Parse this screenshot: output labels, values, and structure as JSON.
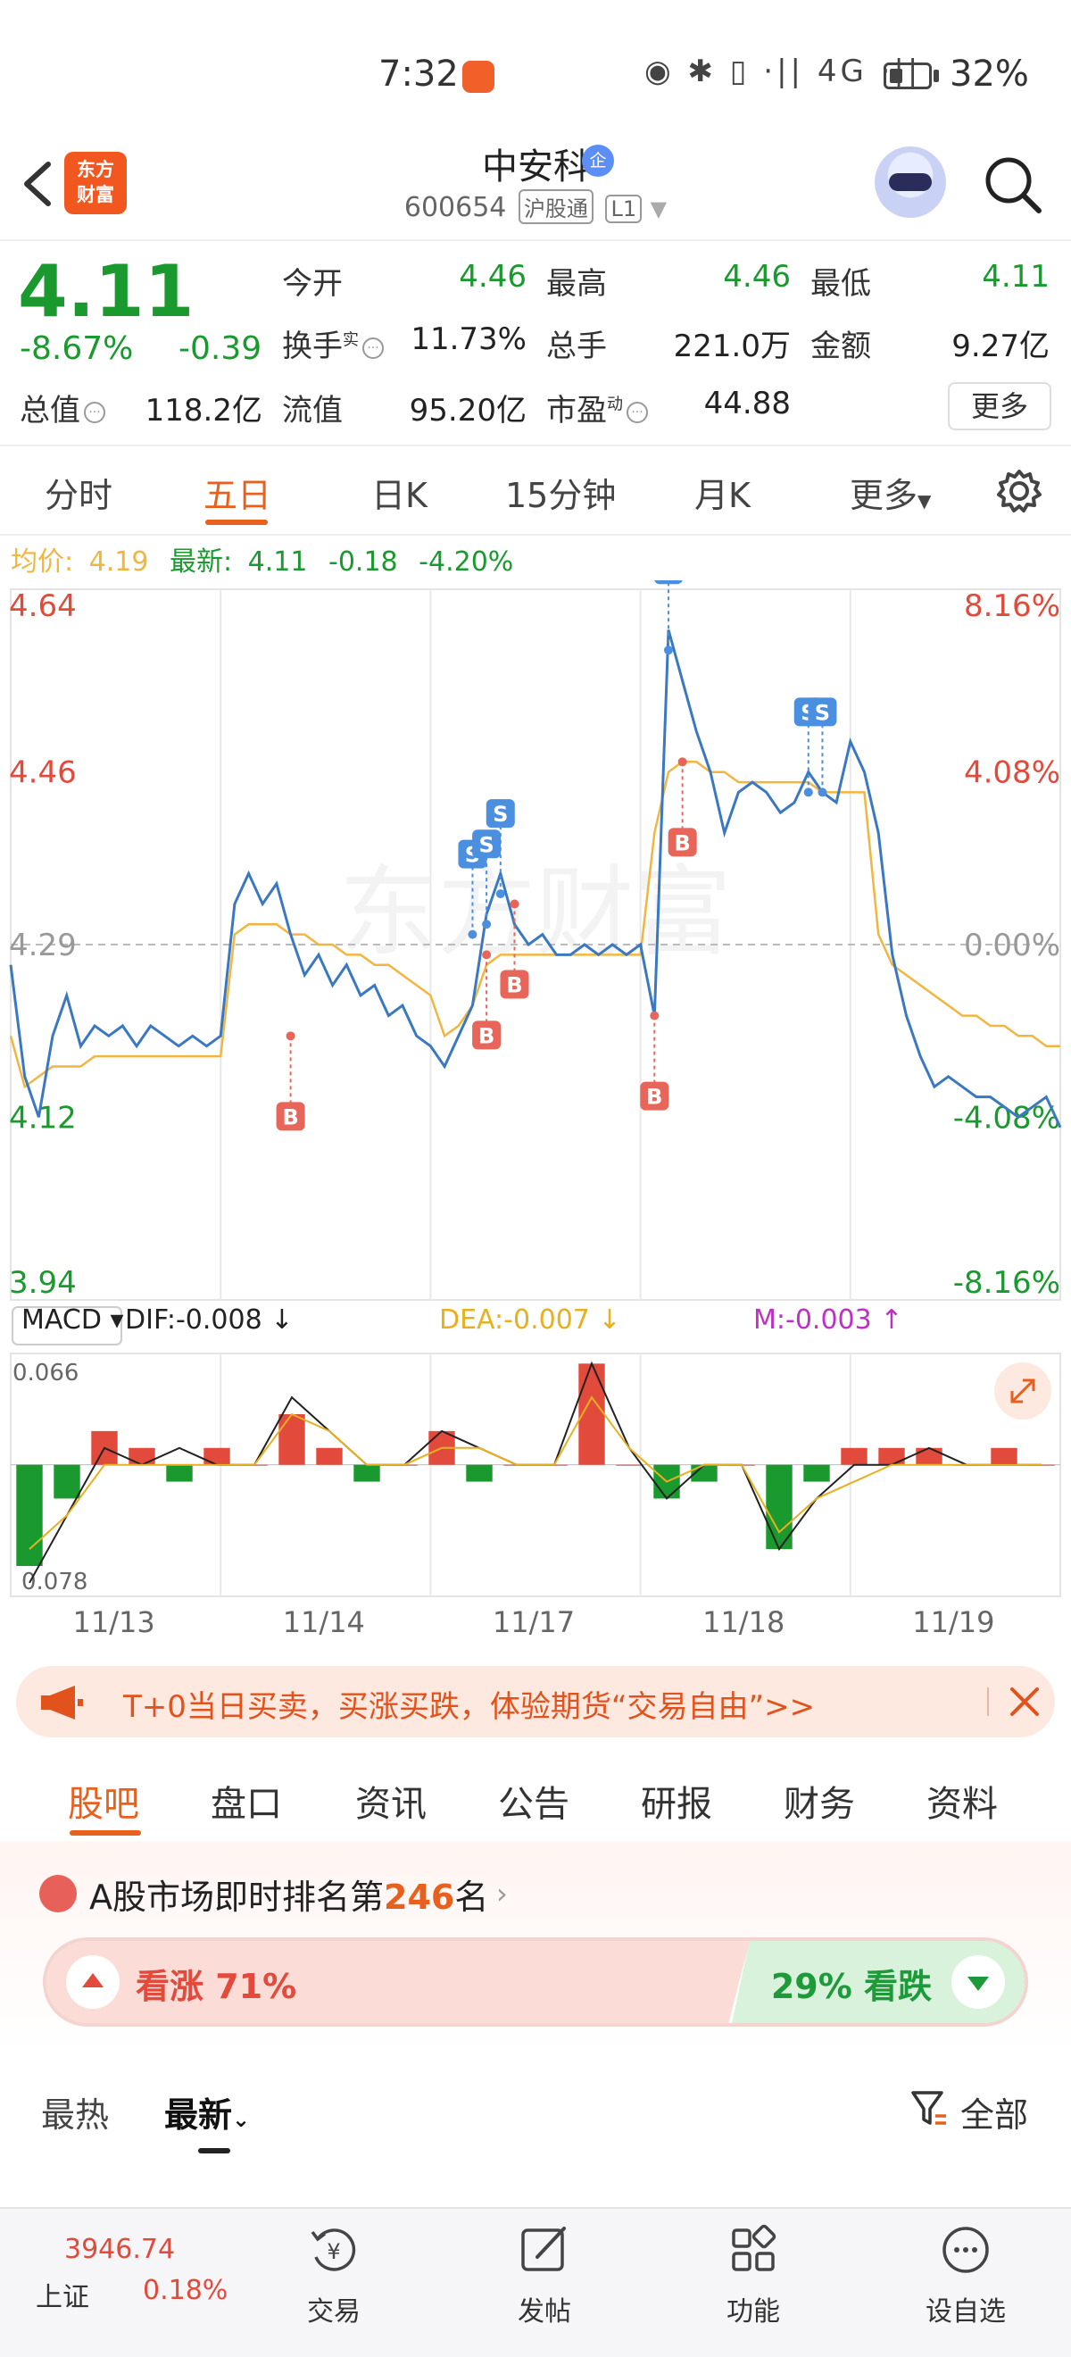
{
  "status_bar": {
    "time": "7:32",
    "battery": "32%",
    "signal_icons": "◉ ✱ ▯ ·|| 4G ·||"
  },
  "header": {
    "logo_text": "东方\n财富",
    "stock_name": "中安科",
    "badge": "企",
    "stock_code": "600654",
    "tag_connect": "沪股通",
    "tag_level": "L1"
  },
  "quote": {
    "price": "4.11",
    "change_pct": "-8.67%",
    "change_abs": "-0.39",
    "open_label": "今开",
    "open": "4.46",
    "high_label": "最高",
    "high": "4.46",
    "low_label": "最低",
    "low": "4.11",
    "turnover_label": "换手",
    "turnover_sup": "实",
    "turnover": "11.73%",
    "volume_label": "总手",
    "volume": "221.0万",
    "amount_label": "金额",
    "amount": "9.27亿",
    "mktcap_label": "总值",
    "mktcap": "118.2亿",
    "float_label": "流值",
    "float_cap": "95.20亿",
    "pe_label": "市盈",
    "pe_sup": "动",
    "pe": "44.88",
    "more_label": "更多"
  },
  "chart_tabs": [
    "分时",
    "五日",
    "日K",
    "15分钟",
    "月K",
    "更多"
  ],
  "active_chart_tab": 1,
  "legend": {
    "avg_label": "均价:",
    "avg_val": "4.19",
    "latest_label": "最新:",
    "latest_val": "4.11",
    "latest_chg": "-0.18",
    "latest_pct": "-4.20%"
  },
  "macd": {
    "name": "MACD",
    "dif": "DIF:-0.008",
    "dea": "DEA:-0.007",
    "m": "M:-0.003"
  },
  "banner": {
    "text": "T+0当日买卖，买涨买跌，体验期货“交易自由”>>"
  },
  "section_tabs": [
    "股吧",
    "盘口",
    "资讯",
    "公告",
    "研报",
    "财务",
    "资料"
  ],
  "rank": {
    "prefix": "A股市场即时排名第",
    "num": "246",
    "suffix": "名"
  },
  "vote": {
    "up": "看涨 71%",
    "down": "29% 看跌",
    "up_ratio": 0.71
  },
  "sort": {
    "hot": "最热",
    "latest": "最新",
    "filter": "全部"
  },
  "bottom_nav": {
    "index_value": "3946.74",
    "index_name": "上证",
    "index_pct": "0.18%",
    "items": [
      "交易",
      "发帖",
      "功能",
      "设自选"
    ]
  },
  "colors": {
    "accent": "#e8601e",
    "up": "#e24a3b",
    "down": "#1a9a2e",
    "price_line": "#3a78c2",
    "avg_line": "#f2b640"
  },
  "chart_data": [
    {
      "type": "line",
      "title": "五日分时",
      "x_categories": [
        "11/13",
        "11/14",
        "11/17",
        "11/18",
        "11/19"
      ],
      "y_left_ticks": [
        "4.64",
        "4.46",
        "4.29",
        "4.12",
        "3.94"
      ],
      "y_right_ticks": [
        "8.16%",
        "4.08%",
        "0.00%",
        "-4.08%",
        "-8.16%"
      ],
      "ylim": [
        3.94,
        4.64
      ],
      "prev_close": 4.29,
      "series": [
        {
          "name": "价格",
          "values": [
            4.27,
            4.16,
            4.12,
            4.2,
            4.24,
            4.19,
            4.21,
            4.2,
            4.21,
            4.19,
            4.21,
            4.2,
            4.19,
            4.2,
            4.19,
            4.2,
            4.33,
            4.36,
            4.33,
            4.35,
            4.3,
            4.26,
            4.28,
            4.25,
            4.27,
            4.24,
            4.25,
            4.22,
            4.23,
            4.2,
            4.19,
            4.17,
            4.2,
            4.23,
            4.32,
            4.36,
            4.31,
            4.29,
            4.3,
            4.28,
            4.28,
            4.29,
            4.28,
            4.29,
            4.28,
            4.29,
            4.22,
            4.6,
            4.55,
            4.5,
            4.46,
            4.4,
            4.44,
            4.45,
            4.44,
            4.42,
            4.43,
            4.46,
            4.44,
            4.43,
            4.49,
            4.46,
            4.4,
            4.28,
            4.22,
            4.18,
            4.15,
            4.16,
            4.15,
            4.14,
            4.14,
            4.13,
            4.12,
            4.13,
            4.14,
            4.11
          ]
        },
        {
          "name": "均价",
          "values": [
            4.2,
            4.15,
            4.16,
            4.17,
            4.17,
            4.17,
            4.18,
            4.18,
            4.18,
            4.18,
            4.18,
            4.18,
            4.18,
            4.18,
            4.18,
            4.18,
            4.3,
            4.31,
            4.31,
            4.31,
            4.3,
            4.3,
            4.29,
            4.29,
            4.28,
            4.28,
            4.27,
            4.27,
            4.26,
            4.25,
            4.24,
            4.2,
            4.21,
            4.23,
            4.27,
            4.28,
            4.28,
            4.28,
            4.28,
            4.28,
            4.28,
            4.28,
            4.28,
            4.28,
            4.28,
            4.28,
            4.4,
            4.46,
            4.47,
            4.47,
            4.46,
            4.46,
            4.45,
            4.45,
            4.45,
            4.45,
            4.45,
            4.45,
            4.44,
            4.44,
            4.44,
            4.44,
            4.3,
            4.27,
            4.26,
            4.25,
            4.24,
            4.23,
            4.22,
            4.22,
            4.21,
            4.21,
            4.2,
            4.2,
            4.19,
            4.19
          ]
        }
      ],
      "markers": [
        {
          "label": "B",
          "x_index": 20,
          "price": 4.2
        },
        {
          "label": "B",
          "x_index": 34,
          "price": 4.28
        },
        {
          "label": "B",
          "x_index": 36,
          "price": 4.33
        },
        {
          "label": "S",
          "x_index": 33,
          "price": 4.3
        },
        {
          "label": "S",
          "x_index": 34,
          "price": 4.31
        },
        {
          "label": "S",
          "x_index": 35,
          "price": 4.34
        },
        {
          "label": "B",
          "x_index": 46,
          "price": 4.22
        },
        {
          "label": "B",
          "x_index": 48,
          "price": 4.47
        },
        {
          "label": "S",
          "x_index": 47,
          "price": 4.58
        },
        {
          "label": "S",
          "x_index": 57,
          "price": 4.44
        },
        {
          "label": "S",
          "x_index": 58,
          "price": 4.44
        }
      ]
    },
    {
      "type": "bar",
      "title": "MACD",
      "y_ticks": [
        "0.066",
        "0.078"
      ],
      "series": [
        {
          "name": "DIF",
          "values": [
            -0.07,
            -0.03,
            0.01,
            0.0,
            0.01,
            0.0,
            0.0,
            0.04,
            0.02,
            0.0,
            0.0,
            0.02,
            0.01,
            0.0,
            0.0,
            0.06,
            0.01,
            -0.02,
            0.0,
            0.0,
            -0.05,
            -0.02,
            0.0,
            0.0,
            0.01,
            0.0,
            0.0,
            0.0
          ]
        },
        {
          "name": "DEA",
          "values": [
            -0.05,
            -0.03,
            0.0,
            0.0,
            0.0,
            0.0,
            0.0,
            0.03,
            0.02,
            0.0,
            0.0,
            0.01,
            0.01,
            0.0,
            0.0,
            0.04,
            0.01,
            -0.01,
            0.0,
            0.0,
            -0.04,
            -0.02,
            -0.01,
            0.0,
            0.0,
            0.0,
            0.0,
            0.0
          ]
        },
        {
          "name": "M",
          "values": [
            -0.06,
            -0.02,
            0.02,
            0.01,
            -0.01,
            0.01,
            0.0,
            0.03,
            0.01,
            -0.01,
            0.0,
            0.02,
            -0.01,
            0.0,
            0.0,
            0.06,
            0.0,
            -0.02,
            -0.01,
            0.0,
            -0.05,
            -0.01,
            0.01,
            0.01,
            0.01,
            0.0,
            0.01,
            0.0
          ]
        }
      ]
    }
  ]
}
